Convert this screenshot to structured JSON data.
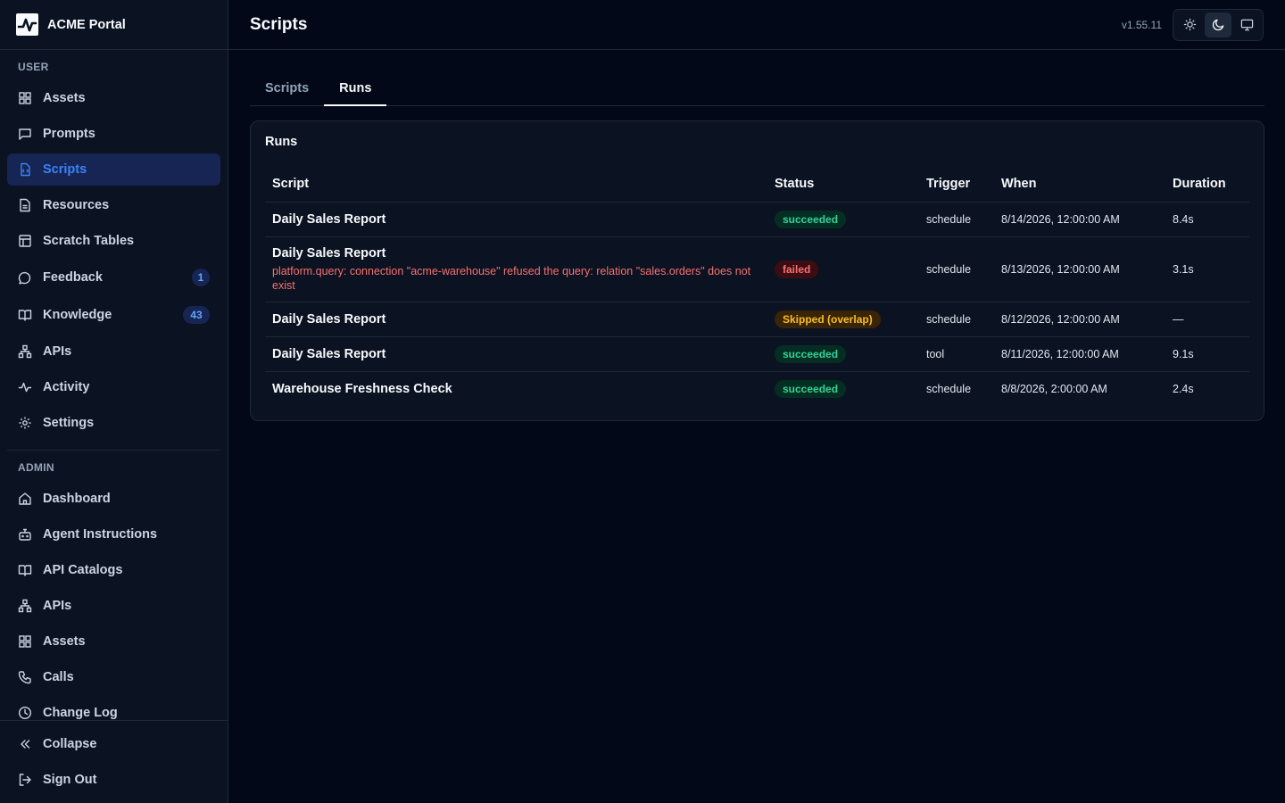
{
  "app": {
    "name": "ACME Portal"
  },
  "sidebar": {
    "user_label": "USER",
    "user_items": [
      {
        "label": "Assets",
        "icon": "grid-icon"
      },
      {
        "label": "Prompts",
        "icon": "message-square-icon"
      },
      {
        "label": "Scripts",
        "icon": "file-code-icon",
        "active": true
      },
      {
        "label": "Resources",
        "icon": "file-text-icon"
      },
      {
        "label": "Scratch Tables",
        "icon": "table-icon"
      },
      {
        "label": "Feedback",
        "icon": "message-circle-icon",
        "badge": "1"
      },
      {
        "label": "Knowledge",
        "icon": "book-open-icon",
        "badge": "43"
      },
      {
        "label": "APIs",
        "icon": "network-icon"
      },
      {
        "label": "Activity",
        "icon": "activity-icon"
      },
      {
        "label": "Settings",
        "icon": "gear-icon"
      }
    ],
    "admin_label": "ADMIN",
    "admin_items": [
      {
        "label": "Dashboard",
        "icon": "home-icon"
      },
      {
        "label": "Agent Instructions",
        "icon": "bot-icon"
      },
      {
        "label": "API Catalogs",
        "icon": "book-open-icon"
      },
      {
        "label": "APIs",
        "icon": "network-icon"
      },
      {
        "label": "Assets",
        "icon": "grid-icon"
      },
      {
        "label": "Calls",
        "icon": "phone-icon"
      },
      {
        "label": "Change Log",
        "icon": "clock-icon"
      }
    ],
    "footer": {
      "collapse": "Collapse",
      "sign_out": "Sign Out"
    }
  },
  "header": {
    "title": "Scripts",
    "version": "v1.55.11"
  },
  "tabs": [
    "Scripts",
    "Runs"
  ],
  "runs": {
    "title": "Runs",
    "columns": [
      "Script",
      "Status",
      "Trigger",
      "When",
      "Duration"
    ],
    "rows": [
      {
        "script": "Daily Sales Report",
        "error": "",
        "status": "succeeded",
        "trigger": "schedule",
        "when": "8/14/2026, 12:00:00 AM",
        "duration": "8.4s"
      },
      {
        "script": "Daily Sales Report",
        "error": "platform.query: connection \"acme-warehouse\" refused the query: relation \"sales.orders\" does not exist",
        "status": "failed",
        "trigger": "schedule",
        "when": "8/13/2026, 12:00:00 AM",
        "duration": "3.1s"
      },
      {
        "script": "Daily Sales Report",
        "error": "",
        "status": "Skipped (overlap)",
        "trigger": "schedule",
        "when": "8/12/2026, 12:00:00 AM",
        "duration": "—"
      },
      {
        "script": "Daily Sales Report",
        "error": "",
        "status": "succeeded",
        "trigger": "tool",
        "when": "8/11/2026, 12:00:00 AM",
        "duration": "9.1s"
      },
      {
        "script": "Warehouse Freshness Check",
        "error": "",
        "status": "succeeded",
        "trigger": "schedule",
        "when": "8/8/2026, 2:00:00 AM",
        "duration": "2.4s"
      }
    ]
  },
  "colors": {
    "accent": "#3b82f6",
    "success": "#34d399",
    "danger": "#f87171",
    "warning": "#fbbf24",
    "background": "#020817"
  }
}
